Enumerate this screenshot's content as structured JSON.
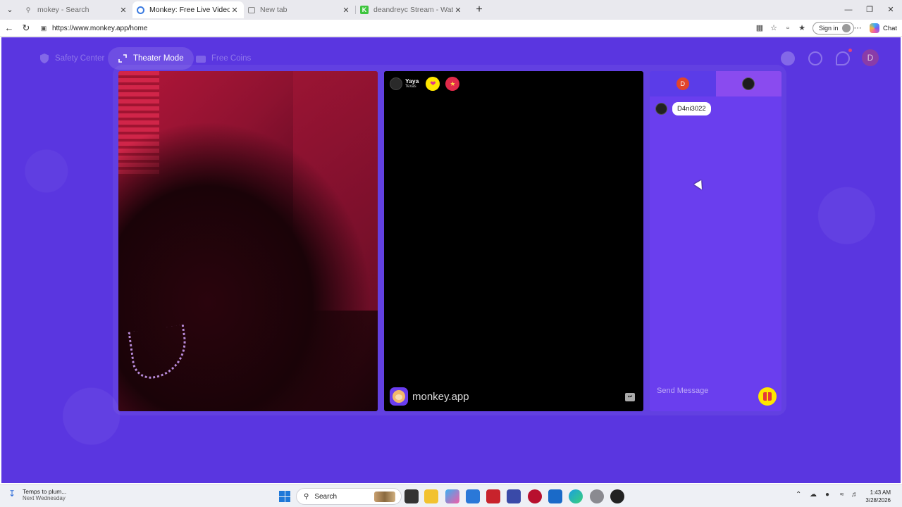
{
  "browser": {
    "tabs": [
      {
        "title": "mokey - Search",
        "active": false,
        "icon": "search-icon"
      },
      {
        "title": "Monkey: Free Live Video Chat",
        "active": true,
        "icon": "monkey-favicon"
      },
      {
        "title": "New tab",
        "active": false,
        "icon": "page-icon"
      },
      {
        "title": "deandreyc Stream - Watch Live on",
        "active": false,
        "icon": "kick-icon"
      }
    ],
    "url": "https://www.monkey.app/home",
    "signin_label": "Sign in",
    "copilot_label": "Chat"
  },
  "topnav": {
    "safety_center": "Safety Center",
    "theater_mode": "Theater Mode",
    "free_coins": "Free Coins",
    "user_initial": "D"
  },
  "partner": {
    "name": "Yaya",
    "location": "Texas"
  },
  "watermark": "monkey.app",
  "chat": {
    "my_initial": "D",
    "messages": [
      {
        "text": "D4ni3022"
      }
    ],
    "placeholder": "Send Message"
  },
  "taskbar": {
    "weather_title": "Temps to plum...",
    "weather_sub": "Next Wednesday",
    "search_label": "Search",
    "time": "1:43 AM",
    "date": "3/28/2026"
  },
  "colors": {
    "page_bg": "#5a36e0",
    "chat_bg": "#6a3eee",
    "accent_yellow": "#ffe600"
  }
}
